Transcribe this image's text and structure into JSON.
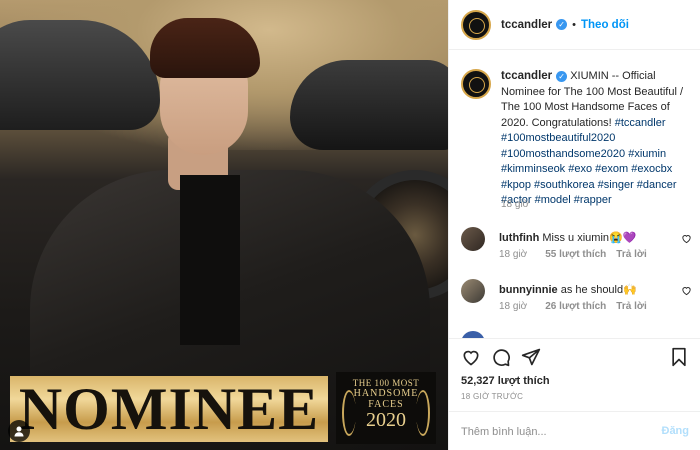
{
  "post": {
    "image_text": {
      "nominee": "NOMINEE",
      "badge_line1": "THE 100 MOST",
      "badge_line2": "HANDSOME",
      "badge_line3": "FACES",
      "badge_year": "2020"
    }
  },
  "header": {
    "username": "tccandler",
    "separator": "•",
    "follow_label": "Theo dõi"
  },
  "caption": {
    "username": "tccandler",
    "text": "XIUMIN -- Official Nominee for The 100 Most Beautiful / The 100 Most Handsome Faces of 2020. Congratulations!",
    "tags": [
      "#tccandler",
      "#100mostbeautiful2020",
      "#100mosthandsome2020",
      "#xiumin",
      "#kimminseok",
      "#exo",
      "#exom",
      "#exocbx",
      "#kpop",
      "#southkorea",
      "#singer",
      "#dancer",
      "#actor",
      "#model",
      "#rapper"
    ],
    "time": "18 giờ"
  },
  "comments": [
    {
      "username": "luthfinh",
      "text": "Miss u xiumin😭💜",
      "time": "18 giờ",
      "likes": "55 lượt thích",
      "reply": "Trả lời"
    },
    {
      "username": "bunnyinnie",
      "text": "as he should🙌",
      "time": "18 giờ",
      "likes": "26 lượt thích",
      "reply": "Trả lời"
    }
  ],
  "actions": {
    "likes": "52,327 lượt thích",
    "time_ago": "18 GIỜ TRƯỚC"
  },
  "comment_box": {
    "placeholder": "Thêm bình luận...",
    "post_label": "Đăng"
  },
  "colors": {
    "accent": "#0095f6",
    "verified": "#3897f0",
    "hashtag": "#00376b",
    "muted": "#8e8e8e",
    "gold": "#d9b56a"
  }
}
